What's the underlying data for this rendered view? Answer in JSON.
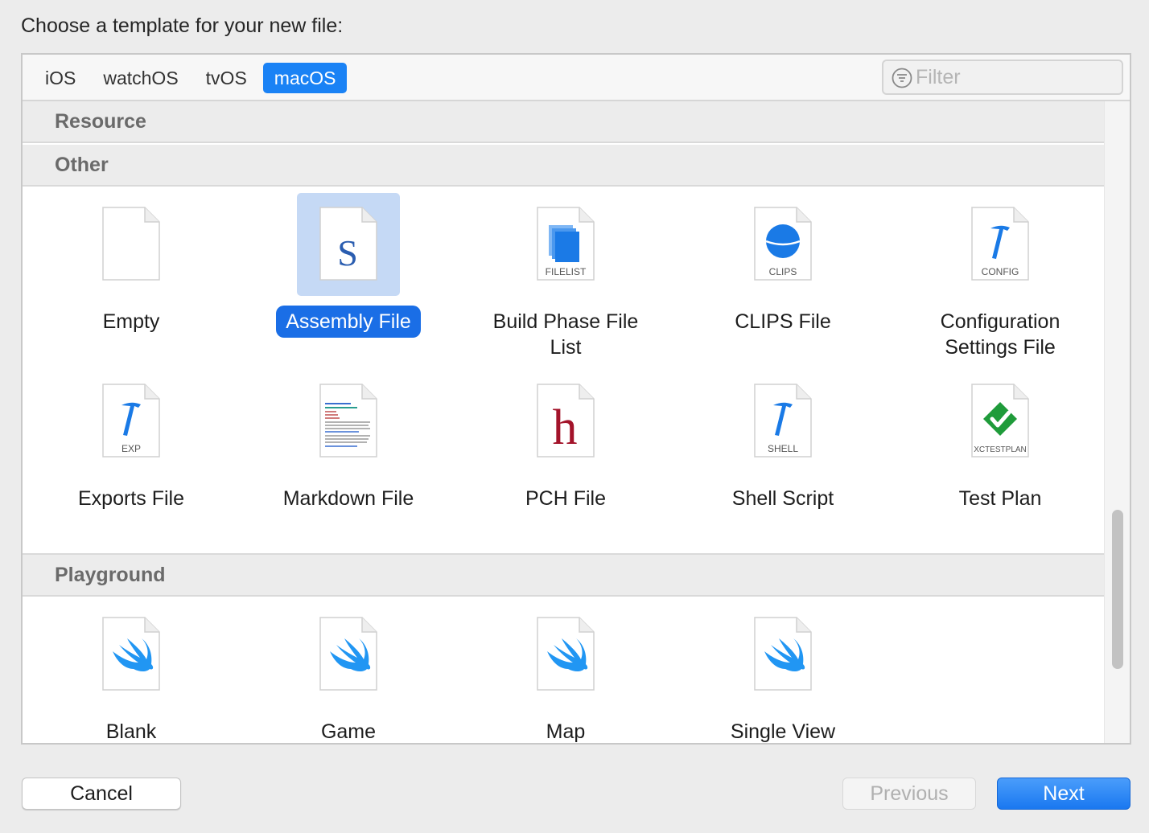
{
  "dialog": {
    "prompt": "Choose a template for your new file:"
  },
  "platform_tabs": {
    "items": [
      {
        "label": "iOS",
        "active": false
      },
      {
        "label": "watchOS",
        "active": false
      },
      {
        "label": "tvOS",
        "active": false
      },
      {
        "label": "macOS",
        "active": true
      }
    ]
  },
  "filter": {
    "placeholder": "Filter",
    "value": "",
    "icon": "filter-icon"
  },
  "sections": {
    "resource": {
      "title": "Resource"
    },
    "other": {
      "title": "Other",
      "items": [
        {
          "label": "Empty",
          "icon": "empty-file-icon",
          "badge": "",
          "selected": false
        },
        {
          "label": "Assembly File",
          "icon": "assembly-file-icon",
          "badge": "S",
          "selected": true
        },
        {
          "label": "Build Phase File List",
          "icon": "filelist-icon",
          "badge": "FILELIST",
          "selected": false
        },
        {
          "label": "CLIPS File",
          "icon": "clips-file-icon",
          "badge": "CLIPS",
          "selected": false
        },
        {
          "label": "Configuration Settings File",
          "icon": "config-file-icon",
          "badge": "CONFIG",
          "selected": false
        },
        {
          "label": "Exports File",
          "icon": "exports-file-icon",
          "badge": "EXP",
          "selected": false
        },
        {
          "label": "Markdown File",
          "icon": "markdown-file-icon",
          "badge": "",
          "selected": false
        },
        {
          "label": "PCH File",
          "icon": "pch-file-icon",
          "badge": "h",
          "selected": false
        },
        {
          "label": "Shell Script",
          "icon": "shell-script-icon",
          "badge": "SHELL",
          "selected": false
        },
        {
          "label": "Test Plan",
          "icon": "test-plan-icon",
          "badge": "XCTESTPLAN",
          "selected": false
        }
      ]
    },
    "playground": {
      "title": "Playground",
      "items": [
        {
          "label": "Blank",
          "icon": "swift-file-icon"
        },
        {
          "label": "Game",
          "icon": "swift-file-icon"
        },
        {
          "label": "Map",
          "icon": "swift-file-icon"
        },
        {
          "label": "Single View",
          "icon": "swift-file-icon"
        }
      ]
    }
  },
  "buttons": {
    "cancel": "Cancel",
    "previous": "Previous",
    "next": "Next"
  },
  "colors": {
    "accent": "#1a82f5",
    "selection_bg": "#c5d9f5",
    "swift": "#2196f3",
    "pch": "#a3132a",
    "testplan": "#1f9b3a"
  }
}
